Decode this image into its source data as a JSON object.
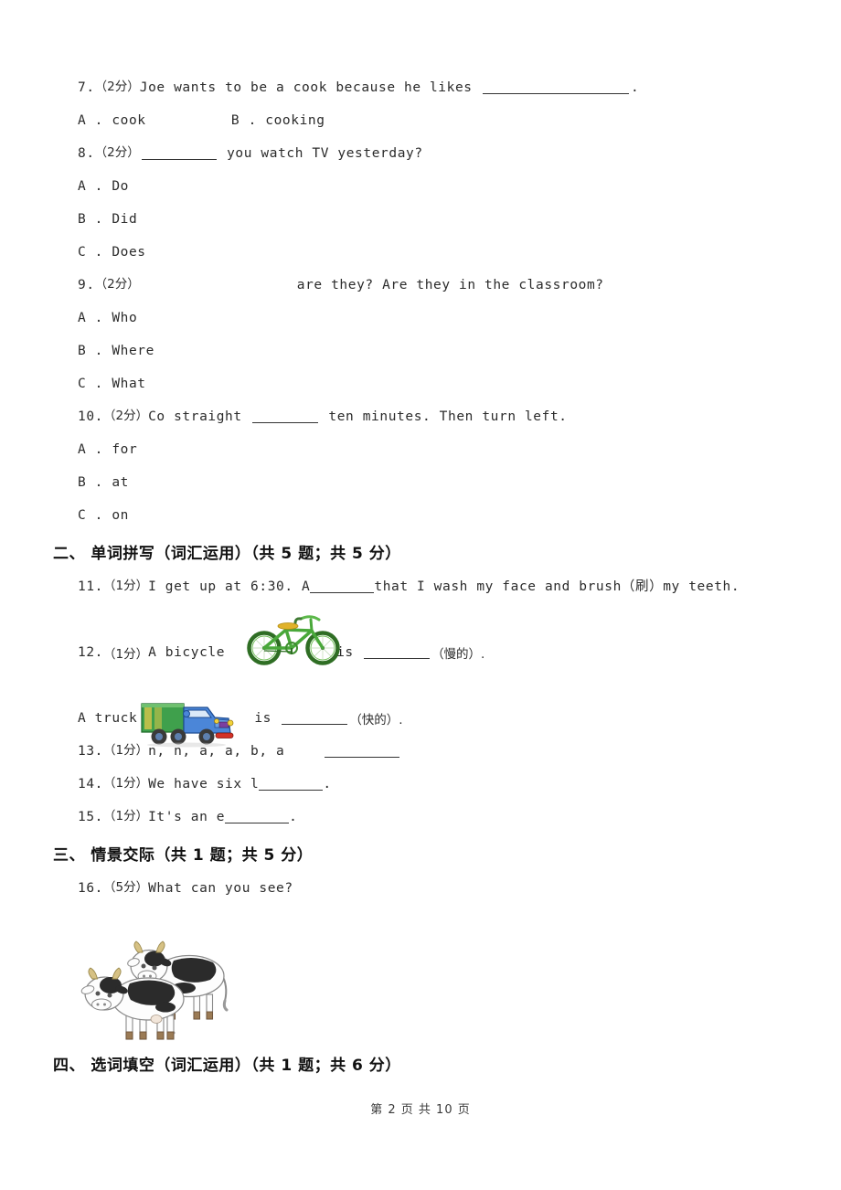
{
  "document": {
    "type": "exam-paper",
    "page_footer": "第 2 页 共 10 页"
  },
  "questions": [
    {
      "id": "q7",
      "number": "7.",
      "points": "（2分）",
      "stem_before": "Joe wants to be a cook because he likes ",
      "stem_after": ".",
      "options_inline": "A . cook          B . cooking"
    },
    {
      "id": "q8",
      "number": "8.",
      "points": "（2分）",
      "stem_before": "",
      "stem_after": " you watch TV yesterday?",
      "options": [
        "A . Do",
        "B . Did",
        "C . Does"
      ]
    },
    {
      "id": "q9",
      "number": "9.",
      "points": "（2分）",
      "stem_after": "are they? Are they in the classroom?",
      "options": [
        "A . Who",
        "B . Where",
        "C . What"
      ]
    },
    {
      "id": "q10",
      "number": "10.",
      "points": "（2分）",
      "stem_before": "Co straight ",
      "stem_after": " ten minutes. Then turn left.",
      "options": [
        "A . for",
        "B . at",
        "C . on"
      ]
    },
    {
      "id": "q11",
      "number": "11.",
      "points": "（1分）",
      "stem_before": "I get up at 6:30. A",
      "stem_after": "that I wash my face and brush（刷）my teeth."
    },
    {
      "id": "q12",
      "number": "12.",
      "points": "（1分）",
      "stem_before": "A bicycle",
      "stem_mid": "is ",
      "stem_after": "（慢的）.",
      "line2_before": "A truck",
      "line2_mid": "is ",
      "line2_after": "（快的）."
    },
    {
      "id": "q13",
      "number": "13.",
      "points": "（1分）",
      "stem_before": "n, n, a, a, b, a"
    },
    {
      "id": "q14",
      "number": "14.",
      "points": "（1分）",
      "stem_before": "We have six l",
      "stem_after": "."
    },
    {
      "id": "q15",
      "number": "15.",
      "points": "（1分）",
      "stem_before": "It's an e",
      "stem_after": "."
    },
    {
      "id": "q16",
      "number": "16.",
      "points": "（5分）",
      "stem_before": "What can you see?"
    }
  ],
  "sections": [
    {
      "id": "sec2",
      "title": "二、 单词拼写（词汇运用）（共 5 题；共 5 分）"
    },
    {
      "id": "sec3",
      "title": "三、 情景交际（共 1 题；共 5 分）"
    },
    {
      "id": "sec4",
      "title": "四、 选词填空（词汇运用）（共 1 题；共 6 分）"
    }
  ],
  "figures": [
    {
      "id": "bicycle",
      "name": "bicycle-illustration",
      "colors": {
        "frame": "#4aa63c",
        "seat": "#e0b020",
        "tire": "#2d6b22"
      }
    },
    {
      "id": "truck",
      "name": "truck-illustration",
      "colors": {
        "cargo": "#3d9e4a",
        "cab": "#3f7fd0",
        "bumper": "#cc2222"
      }
    },
    {
      "id": "cows",
      "name": "two-cows-illustration",
      "colors": {
        "body": "#fdfdfd",
        "spots": "#2a2a2a",
        "horns": "#cbb071"
      }
    }
  ]
}
